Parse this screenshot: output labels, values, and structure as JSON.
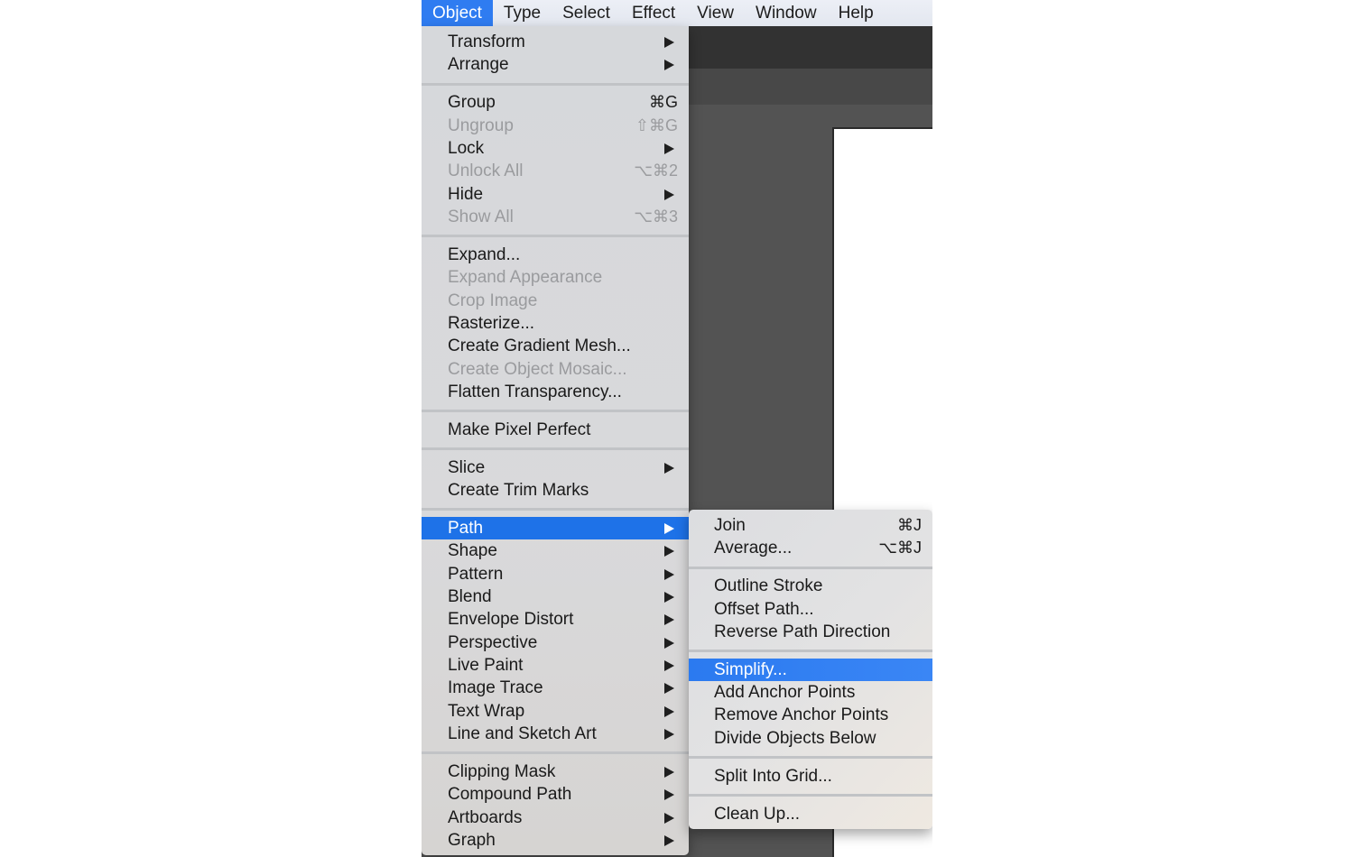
{
  "menubar": {
    "items": [
      {
        "label": "Object",
        "active": true
      },
      {
        "label": "Type"
      },
      {
        "label": "Select"
      },
      {
        "label": "Effect"
      },
      {
        "label": "View"
      },
      {
        "label": "Window"
      },
      {
        "label": "Help"
      }
    ]
  },
  "object_menu": {
    "items": [
      {
        "label": "Transform",
        "submenu": true
      },
      {
        "label": "Arrange",
        "submenu": true
      },
      {
        "separator": true
      },
      {
        "label": "Group",
        "shortcut": "⌘G"
      },
      {
        "label": "Ungroup",
        "shortcut": "⇧⌘G",
        "disabled": true
      },
      {
        "label": "Lock",
        "submenu": true
      },
      {
        "label": "Unlock All",
        "shortcut": "⌥⌘2",
        "disabled": true
      },
      {
        "label": "Hide",
        "submenu": true
      },
      {
        "label": "Show All",
        "shortcut": "⌥⌘3",
        "disabled": true
      },
      {
        "separator": true
      },
      {
        "label": "Expand..."
      },
      {
        "label": "Expand Appearance",
        "disabled": true
      },
      {
        "label": "Crop Image",
        "disabled": true
      },
      {
        "label": "Rasterize..."
      },
      {
        "label": "Create Gradient Mesh..."
      },
      {
        "label": "Create Object Mosaic...",
        "disabled": true
      },
      {
        "label": "Flatten Transparency..."
      },
      {
        "separator": true
      },
      {
        "label": "Make Pixel Perfect"
      },
      {
        "separator": true
      },
      {
        "label": "Slice",
        "submenu": true
      },
      {
        "label": "Create Trim Marks"
      },
      {
        "separator": true
      },
      {
        "label": "Path",
        "submenu": true,
        "highlighted": true
      },
      {
        "label": "Shape",
        "submenu": true
      },
      {
        "label": "Pattern",
        "submenu": true
      },
      {
        "label": "Blend",
        "submenu": true
      },
      {
        "label": "Envelope Distort",
        "submenu": true
      },
      {
        "label": "Perspective",
        "submenu": true
      },
      {
        "label": "Live Paint",
        "submenu": true
      },
      {
        "label": "Image Trace",
        "submenu": true
      },
      {
        "label": "Text Wrap",
        "submenu": true
      },
      {
        "label": "Line and Sketch Art",
        "submenu": true
      },
      {
        "separator": true
      },
      {
        "label": "Clipping Mask",
        "submenu": true
      },
      {
        "label": "Compound Path",
        "submenu": true
      },
      {
        "label": "Artboards",
        "submenu": true
      },
      {
        "label": "Graph",
        "submenu": true
      }
    ]
  },
  "path_submenu": {
    "items": [
      {
        "label": "Join",
        "shortcut": "⌘J"
      },
      {
        "label": "Average...",
        "shortcut": "⌥⌘J"
      },
      {
        "separator": true
      },
      {
        "label": "Outline Stroke"
      },
      {
        "label": "Offset Path..."
      },
      {
        "label": "Reverse Path Direction"
      },
      {
        "separator": true
      },
      {
        "label": "Simplify...",
        "highlighted": true
      },
      {
        "label": "Add Anchor Points"
      },
      {
        "label": "Remove Anchor Points"
      },
      {
        "label": "Divide Objects Below"
      },
      {
        "separator": true
      },
      {
        "label": "Split Into Grid..."
      },
      {
        "separator": true
      },
      {
        "label": "Clean Up..."
      }
    ]
  },
  "colors": {
    "highlight": "#1e72e8",
    "menu_background": "#d8d9db",
    "disabled_text": "#9a9b9e"
  }
}
